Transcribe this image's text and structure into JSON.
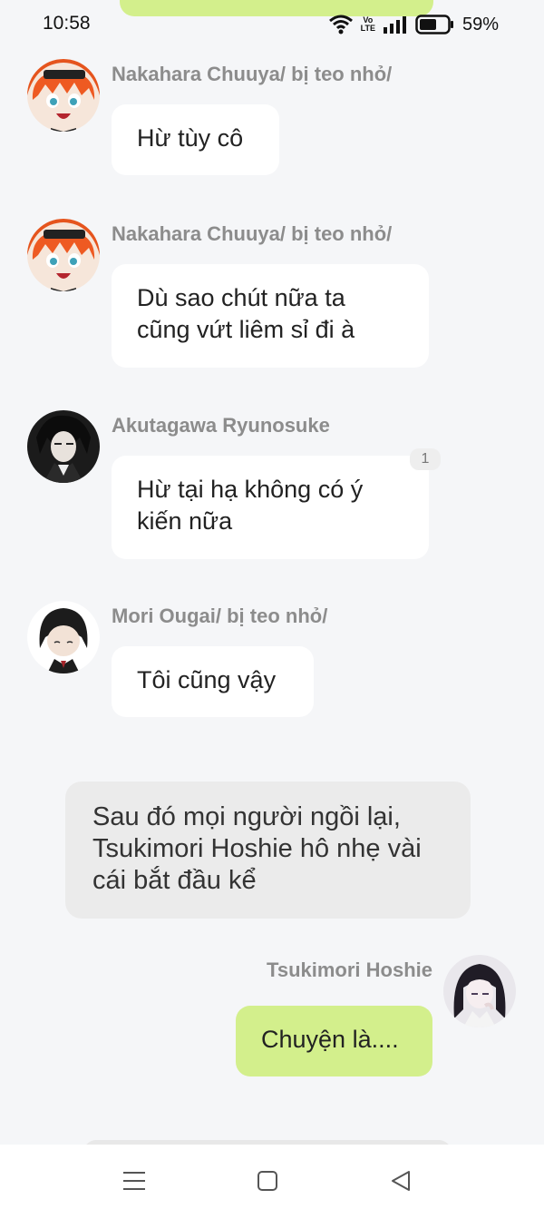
{
  "status": {
    "time": "10:58",
    "network": "LTE",
    "network_prefix": "Vo",
    "battery": "59%"
  },
  "messages": [
    {
      "sender": "Nakahara Chuuya/ bị teo nhỏ/",
      "text": "Hừ tùy cô"
    },
    {
      "sender": "Nakahara Chuuya/ bị teo nhỏ/",
      "text": "Dù sao chút nữa ta cũng vứt liêm sỉ đi à"
    },
    {
      "sender": "Akutagawa Ryunosuke",
      "text": "Hừ tại hạ không có ý kiến nữa",
      "badge": "1"
    },
    {
      "sender": "Mori Ougai/ bị teo nhỏ/",
      "text": "Tôi cũng vậy"
    }
  ],
  "narration": "Sau đó mọi người ngồi lại, Tsukimori Hoshie hô nhẹ vài cái bắt đầu kể",
  "self_message": {
    "sender": "Tsukimori Hoshie",
    "text": "Chuyện là...."
  },
  "colors": {
    "self_bubble": "#d3ef8c",
    "background": "#f5f6f8",
    "bubble": "#ffffff",
    "narration": "#ebebeb"
  },
  "nav": {
    "menu_icon": "menu-icon",
    "home_icon": "home-icon",
    "back_icon": "back-icon"
  }
}
